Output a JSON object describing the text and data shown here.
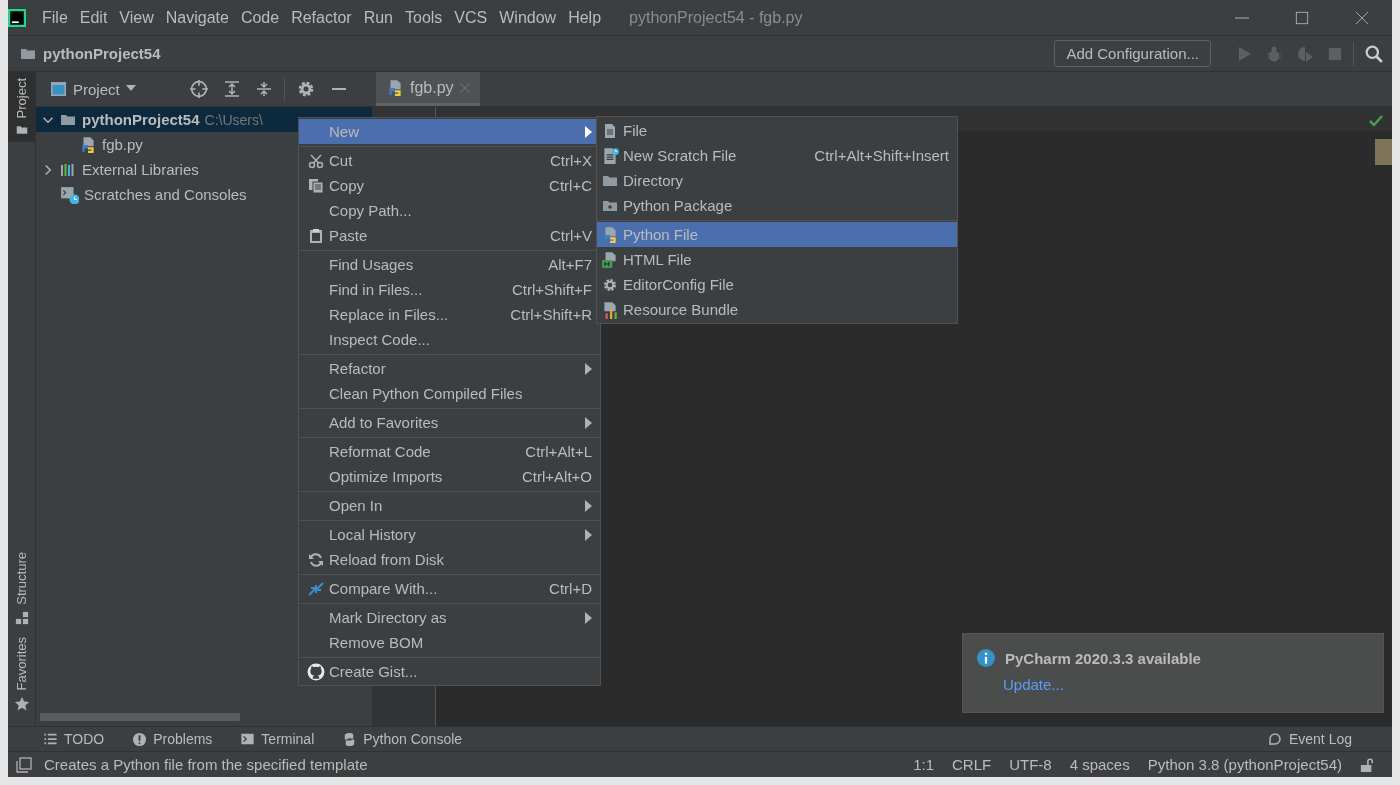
{
  "window": {
    "title": "pythonProject54 - fgb.py"
  },
  "menu_bar": [
    "File",
    "Edit",
    "View",
    "Navigate",
    "Code",
    "Refactor",
    "Run",
    "Tools",
    "VCS",
    "Window",
    "Help"
  ],
  "navigation_bar": {
    "project": "pythonProject54",
    "run_configuration": "Add Configuration..."
  },
  "side_tabs": [
    {
      "label": "Project",
      "selected": true
    },
    {
      "label": "Structure",
      "selected": false
    },
    {
      "label": "Favorites",
      "selected": false
    }
  ],
  "project_panel": {
    "title": "Project",
    "tree": [
      {
        "kind": "project",
        "label": "pythonProject54",
        "path": "C:\\Users\\",
        "selected": true,
        "expanded": true,
        "children": [
          {
            "kind": "python-file",
            "label": "fgb.py",
            "selected": false
          }
        ]
      },
      {
        "kind": "libraries",
        "label": "External Libraries",
        "selected": false,
        "expanded": false
      },
      {
        "kind": "scratches",
        "label": "Scratches and Consoles",
        "selected": false
      }
    ]
  },
  "editor": {
    "tabs": [
      {
        "label": "fgb.py",
        "selected": true
      }
    ]
  },
  "context_menu": {
    "groups": [
      [
        {
          "label": "New",
          "submenu": true,
          "selected": true
        }
      ],
      [
        {
          "label": "Cut",
          "shortcut": "Ctrl+X",
          "submenu": false,
          "selected": false
        },
        {
          "label": "Copy",
          "shortcut": "Ctrl+C",
          "submenu": false,
          "selected": false
        },
        {
          "label": "Copy Path...",
          "submenu": false,
          "selected": false
        },
        {
          "label": "Paste",
          "shortcut": "Ctrl+V",
          "submenu": false,
          "selected": false
        }
      ],
      [
        {
          "label": "Find Usages",
          "shortcut": "Alt+F7",
          "submenu": false,
          "selected": false
        },
        {
          "label": "Find in Files...",
          "shortcut": "Ctrl+Shift+F",
          "submenu": false,
          "selected": false
        },
        {
          "label": "Replace in Files...",
          "shortcut": "Ctrl+Shift+R",
          "submenu": false,
          "selected": false
        },
        {
          "label": "Inspect Code...",
          "submenu": false,
          "selected": false
        }
      ],
      [
        {
          "label": "Refactor",
          "submenu": true,
          "selected": false
        },
        {
          "label": "Clean Python Compiled Files",
          "submenu": false,
          "selected": false
        }
      ],
      [
        {
          "label": "Add to Favorites",
          "submenu": true,
          "selected": false
        }
      ],
      [
        {
          "label": "Reformat Code",
          "shortcut": "Ctrl+Alt+L",
          "submenu": false,
          "selected": false
        },
        {
          "label": "Optimize Imports",
          "shortcut": "Ctrl+Alt+O",
          "submenu": false,
          "selected": false
        }
      ],
      [
        {
          "label": "Open In",
          "submenu": true,
          "selected": false
        }
      ],
      [
        {
          "label": "Local History",
          "submenu": true,
          "selected": false
        },
        {
          "label": "Reload from Disk",
          "submenu": false,
          "selected": false
        }
      ],
      [
        {
          "label": "Compare With...",
          "shortcut": "Ctrl+D",
          "submenu": false,
          "selected": false
        }
      ],
      [
        {
          "label": "Mark Directory as",
          "submenu": true,
          "selected": false
        },
        {
          "label": "Remove BOM",
          "submenu": false,
          "selected": false
        }
      ],
      [
        {
          "label": "Create Gist...",
          "submenu": false,
          "selected": false
        }
      ]
    ]
  },
  "submenu": {
    "groups": [
      [
        {
          "label": "File",
          "submenu": false,
          "selected": false
        },
        {
          "label": "New Scratch File",
          "shortcut": "Ctrl+Alt+Shift+Insert",
          "submenu": false,
          "selected": false
        },
        {
          "label": "Directory",
          "submenu": false,
          "selected": false
        },
        {
          "label": "Python Package",
          "submenu": false,
          "selected": false
        }
      ],
      [
        {
          "label": "Python File",
          "submenu": false,
          "selected": true
        },
        {
          "label": "HTML File",
          "submenu": false,
          "selected": false
        },
        {
          "label": "EditorConfig File",
          "submenu": false,
          "selected": false
        },
        {
          "label": "Resource Bundle",
          "submenu": false,
          "selected": false
        }
      ]
    ]
  },
  "notification": {
    "title": "PyCharm 2020.3.3 available",
    "link": "Update..."
  },
  "tool_windows": [
    "TODO",
    "Problems",
    "Terminal",
    "Python Console"
  ],
  "event_log": "Event Log",
  "status_bar": {
    "message": "Creates a Python file from the specified template",
    "items": [
      "1:1",
      "CRLF",
      "UTF-8",
      "4 spaces",
      "Python 3.8 (pythonProject54)"
    ]
  }
}
